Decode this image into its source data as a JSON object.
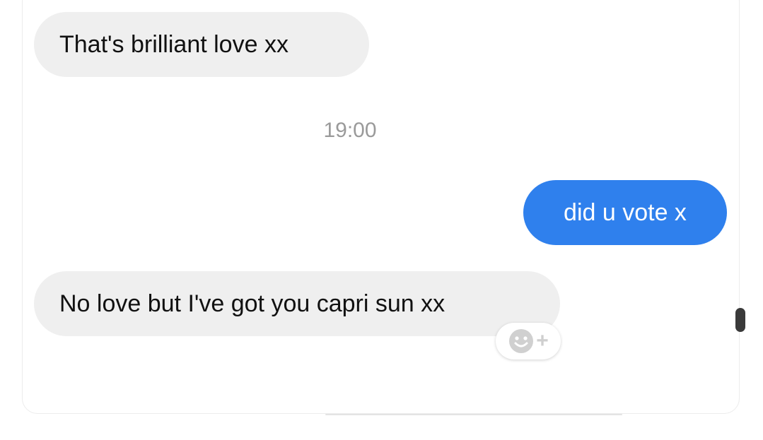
{
  "conversation": {
    "messages": [
      {
        "sender": "them",
        "text": "That's brilliant love xx"
      },
      {
        "sender": "me",
        "text": "did u vote x"
      },
      {
        "sender": "them",
        "text": "No love but I've got you capri sun xx"
      }
    ],
    "timestamp": "19:00"
  },
  "reaction_button": {
    "icon": "smiley-add-icon",
    "plus": "+"
  },
  "colors": {
    "incoming_bubble": "#efefef",
    "outgoing_bubble": "#2f80ed",
    "timestamp_text": "#9a9a9a"
  }
}
